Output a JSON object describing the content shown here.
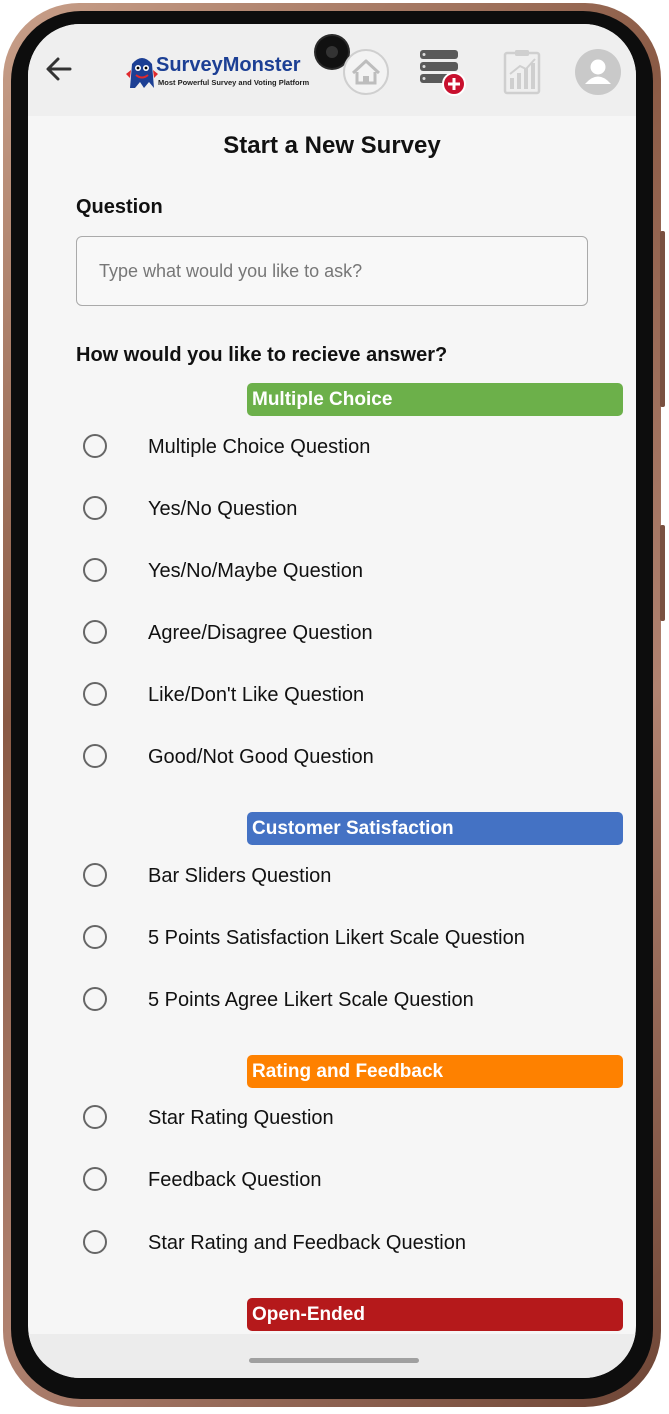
{
  "header": {
    "logo_name": "SurveyMonster",
    "logo_tagline": "Most Powerful Survey and Voting Platform",
    "icons": [
      "back-arrow-icon",
      "home-icon",
      "add-survey-icon",
      "reports-icon",
      "user-avatar-icon"
    ]
  },
  "page": {
    "title": "Start a New Survey",
    "question_label": "Question",
    "question_placeholder": "Type what would you like to ask?",
    "answer_prompt": "How would you like to recieve answer?"
  },
  "categories": [
    {
      "name": "Multiple Choice",
      "color": "#6cb04a",
      "options": [
        "Multiple Choice Question",
        "Yes/No Question",
        "Yes/No/Maybe Question",
        "Agree/Disagree Question",
        "Like/Don't Like Question",
        "Good/Not Good Question"
      ]
    },
    {
      "name": "Customer Satisfaction",
      "color": "#4472c4",
      "options": [
        "Bar Sliders Question",
        "5 Points Satisfaction Likert Scale Question",
        "5 Points Agree Likert Scale Question"
      ]
    },
    {
      "name": "Rating and Feedback",
      "color": "#fe8100",
      "options": [
        "Star Rating Question",
        "Feedback Question",
        "Star Rating and Feedback Question"
      ]
    },
    {
      "name": "Open-Ended",
      "color": "#b5191b",
      "options": []
    }
  ]
}
